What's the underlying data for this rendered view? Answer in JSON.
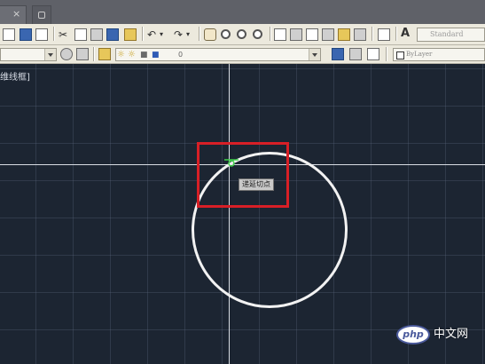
{
  "window": {
    "tab_close_symbol": "×"
  },
  "toolbar": {
    "text_style": "Standard",
    "layer_value": "0",
    "color_value": "ByLayer",
    "icons": [
      "new-icon",
      "open-icon",
      "save-icon",
      "plot-icon",
      "cut-icon",
      "copy-icon",
      "paste-icon",
      "match-properties-icon",
      "undo-icon",
      "redo-icon",
      "pan-icon",
      "zoom-realtime-icon",
      "zoom-window-icon",
      "zoom-previous-icon",
      "properties-icon",
      "design-center-icon",
      "tool-palettes-icon",
      "sheet-set-icon",
      "markup-icon",
      "calculator-icon",
      "help-icon",
      "text-style-icon",
      "layer-manager-icon",
      "layer-state-icon",
      "make-current-icon",
      "layer-previous-icon"
    ]
  },
  "canvas": {
    "viewport_label": "维线框]",
    "tooltip": "递延切点",
    "colors": {
      "background": "#1c2532",
      "grid": "#3a4556",
      "crosshair": "#d9dde3",
      "circle": "#f2f2f2",
      "highlight": "#d81f26",
      "snap_marker": "#3fd04a"
    }
  },
  "watermark": {
    "logo_text": "php",
    "site_text": "中文网"
  }
}
